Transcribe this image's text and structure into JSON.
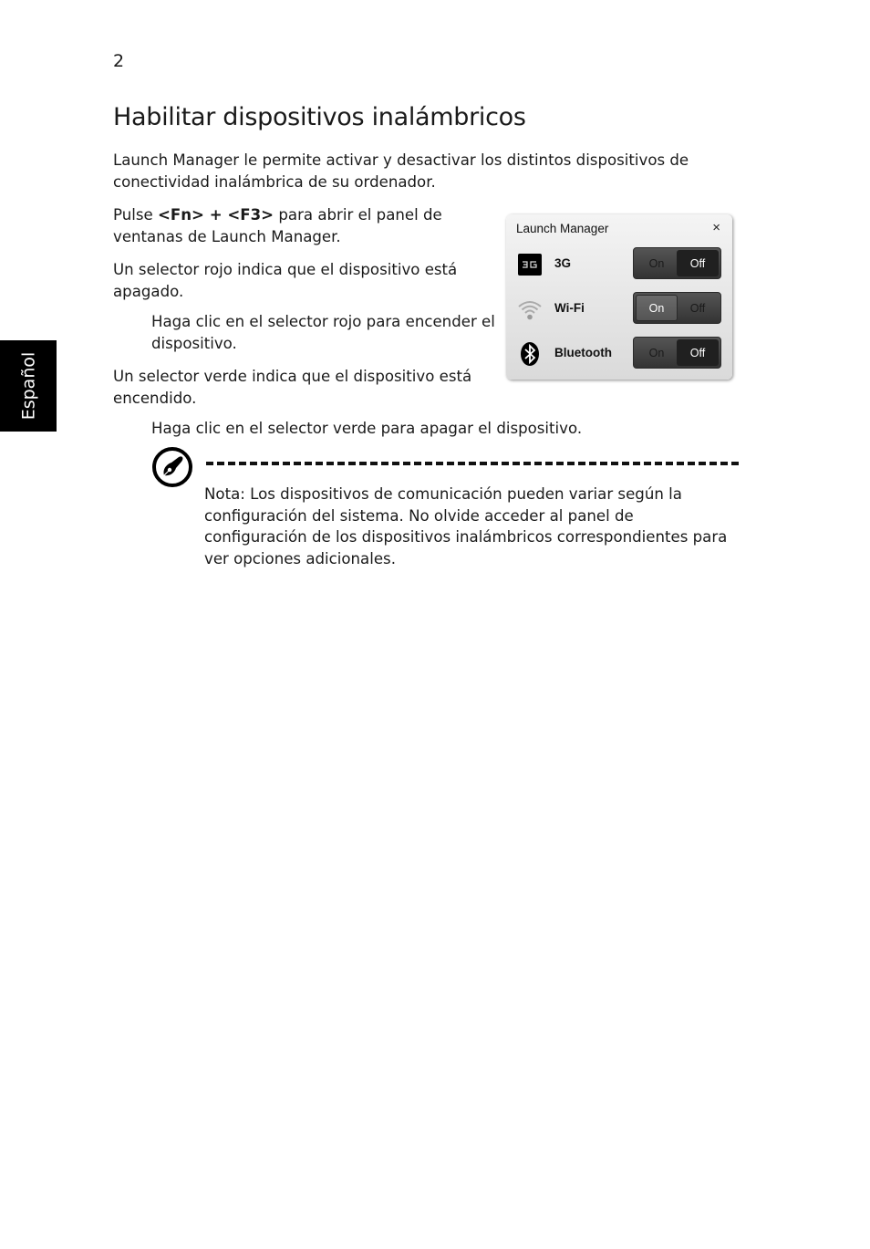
{
  "page": {
    "number": "2",
    "side_tab": "Español",
    "title": "Habilitar dispositivos inalámbricos"
  },
  "body": {
    "intro": "Launch Manager le permite activar y desactivar los distintos dispositivos de conectividad inalámbrica de su ordenador.",
    "p1_prefix": "Pulse ",
    "p1_keys": "<Fn> + <F3>",
    "p1_suffix": " para abrir el panel de ventanas de Launch Manager.",
    "p2": "Un selector rojo indica que el dispositivo está apagado.",
    "p3": "Haga clic en el selector rojo para encender el dispositivo.",
    "p4": "Un selector verde indica que el dispositivo está encendido.",
    "p5": "Haga clic en el selector verde para apagar el dispositivo."
  },
  "launch_manager": {
    "title": "Launch Manager",
    "close_glyph": "×",
    "devices": [
      {
        "name": "3G",
        "icon": "3g-icon",
        "on_label": "On",
        "off_label": "Off",
        "state": "off"
      },
      {
        "name": "Wi-Fi",
        "icon": "wifi-icon",
        "on_label": "On",
        "off_label": "Off",
        "state": "on"
      },
      {
        "name": "Bluetooth",
        "icon": "bluetooth-icon",
        "on_label": "On",
        "off_label": "Off",
        "state": "off"
      }
    ]
  },
  "note": {
    "icon": "note-pen-icon",
    "label": "Nota:",
    "text": " Los dispositivos de comunicación pueden variar según la configuración del sistema. No olvide acceder al panel de configuración de los dispositivos inalámbricos correspondientes para ver opciones adicionales."
  }
}
